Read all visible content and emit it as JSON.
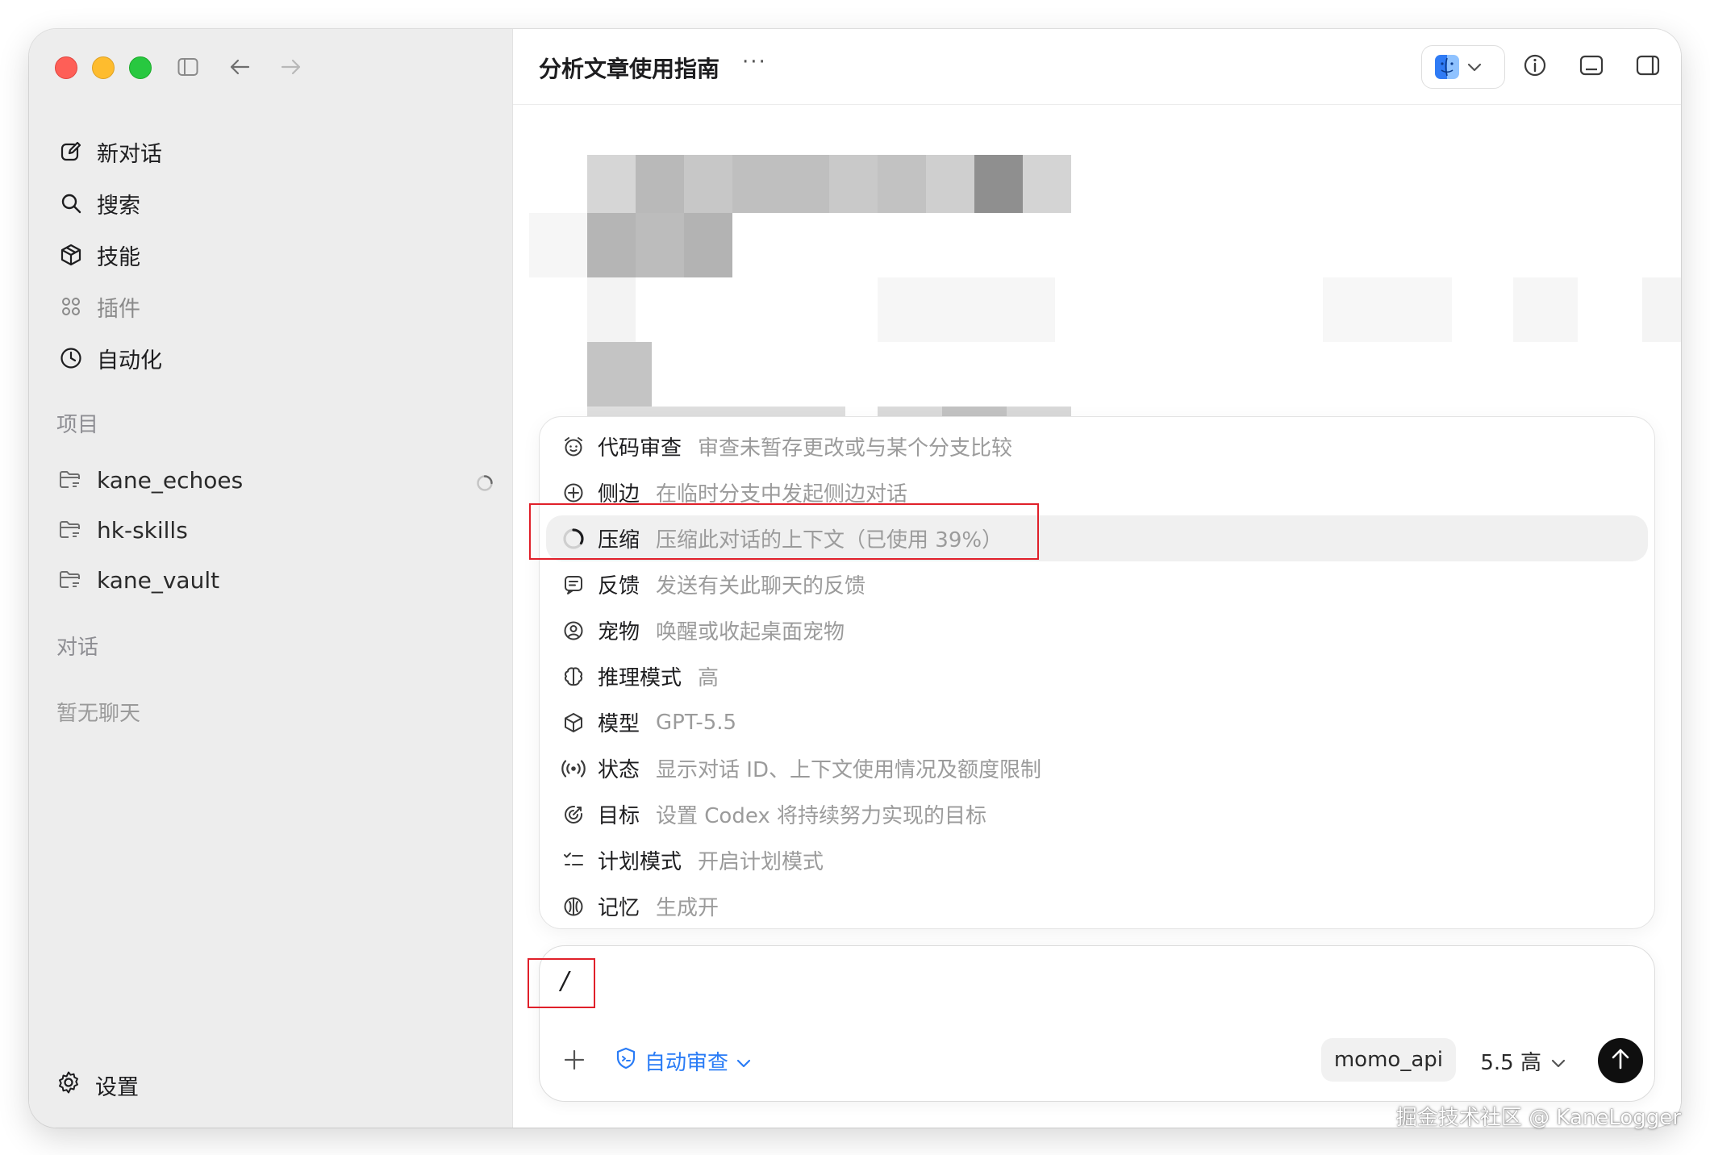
{
  "sidebar": {
    "nav": [
      {
        "label": "新对话",
        "icon": "edit-icon"
      },
      {
        "label": "搜索",
        "icon": "search-icon"
      },
      {
        "label": "技能",
        "icon": "cube-icon"
      },
      {
        "label": "插件",
        "icon": "grid-icon"
      },
      {
        "label": "自动化",
        "icon": "clock-icon"
      }
    ],
    "projects_label": "项目",
    "projects": [
      {
        "name": "kane_echoes",
        "loading": true
      },
      {
        "name": "hk-skills"
      },
      {
        "name": "kane_vault"
      }
    ],
    "chats_label": "对话",
    "chats_empty": "暂无聊天",
    "settings_label": "设置"
  },
  "header": {
    "title": "分析文章使用指南",
    "more": "···"
  },
  "menu": {
    "items": [
      {
        "cmd": "代码审查",
        "desc": "审查未暂存更改或与某个分支比较",
        "icon": "alarm-icon"
      },
      {
        "cmd": "侧边",
        "desc": "在临时分支中发起侧边对话",
        "icon": "plus-circle-icon"
      },
      {
        "cmd": "压缩",
        "desc": "压缩此对话的上下文（已使用 39%）",
        "icon": "progress-ring-icon",
        "active": true
      },
      {
        "cmd": "反馈",
        "desc": "发送有关此聊天的反馈",
        "icon": "feedback-icon"
      },
      {
        "cmd": "宠物",
        "desc": "唤醒或收起桌面宠物",
        "icon": "pet-icon"
      },
      {
        "cmd": "推理模式",
        "desc": "高",
        "icon": "brain-icon"
      },
      {
        "cmd": "模型",
        "desc": "GPT-5.5",
        "icon": "box-icon"
      },
      {
        "cmd": "状态",
        "desc": "显示对话 ID、上下文使用情况及额度限制",
        "icon": "broadcast-icon"
      },
      {
        "cmd": "目标",
        "desc": "设置 Codex 将持续努力实现的目标",
        "icon": "target-icon"
      },
      {
        "cmd": "计划模式",
        "desc": "开启计划模式",
        "icon": "checklist-icon"
      },
      {
        "cmd": "记忆",
        "desc": "生成开",
        "icon": "memory-icon"
      }
    ]
  },
  "composer": {
    "text": "/",
    "auto_review": "自动审查",
    "model_chip": "momo_api",
    "model_version": "5.5 高"
  },
  "watermark": "掘金技术社区 @ KaneLogger",
  "colors": {
    "accent": "#2a7cf6",
    "highlight": "#e0202a"
  },
  "context_used_pct": 39
}
